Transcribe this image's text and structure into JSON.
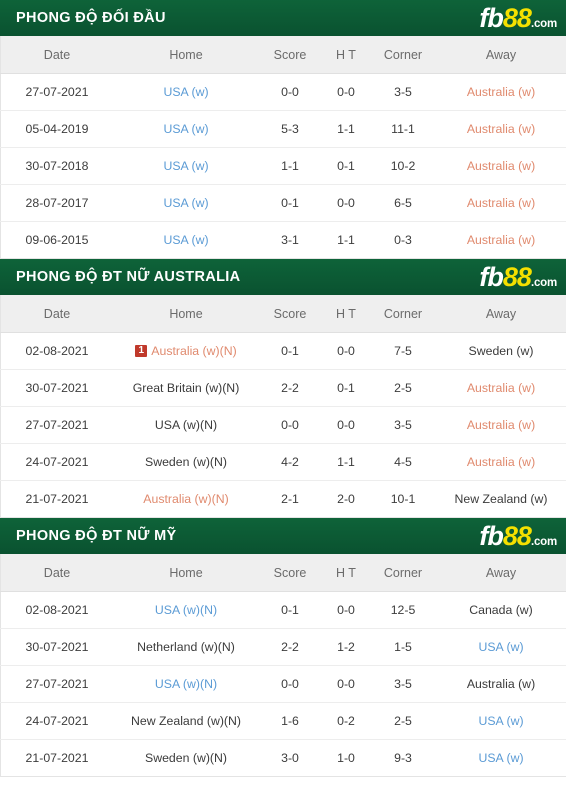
{
  "brand": {
    "logo_fb": "fb",
    "logo_88": "88",
    "logo_dotcom": ".com"
  },
  "colors": {
    "banner_green": "#0c5c35",
    "logo_yellow": "#f5e000",
    "score_red": "#cf4b4b",
    "link_blue": "#5b9bd5",
    "highlight_salmon": "#e08a6e",
    "badge_red": "#c0392b",
    "header_row_grey": "#efefef"
  },
  "columns": {
    "date": "Date",
    "home": "Home",
    "score": "Score",
    "ht": "H T",
    "corner": "Corner",
    "away": "Away"
  },
  "sections": [
    {
      "id": "head-to-head",
      "title": "PHONG ĐỘ ĐỐI ĐẦU",
      "rows": [
        {
          "date": "27-07-2021",
          "home": {
            "text": "USA (w)",
            "style": "blue",
            "badge": null
          },
          "score": "0-0",
          "ht": "0-0",
          "corner": "3-5",
          "away": {
            "text": "Australia (w)",
            "style": "salmon",
            "badge": null
          }
        },
        {
          "date": "05-04-2019",
          "home": {
            "text": "USA (w)",
            "style": "blue",
            "badge": null
          },
          "score": "5-3",
          "ht": "1-1",
          "corner": "11-1",
          "away": {
            "text": "Australia (w)",
            "style": "salmon",
            "badge": null
          }
        },
        {
          "date": "30-07-2018",
          "home": {
            "text": "USA (w)",
            "style": "blue",
            "badge": null
          },
          "score": "1-1",
          "ht": "0-1",
          "corner": "10-2",
          "away": {
            "text": "Australia (w)",
            "style": "salmon",
            "badge": null
          }
        },
        {
          "date": "28-07-2017",
          "home": {
            "text": "USA (w)",
            "style": "blue",
            "badge": null
          },
          "score": "0-1",
          "ht": "0-0",
          "corner": "6-5",
          "away": {
            "text": "Australia (w)",
            "style": "salmon",
            "badge": null
          }
        },
        {
          "date": "09-06-2015",
          "home": {
            "text": "USA (w)",
            "style": "blue",
            "badge": null
          },
          "score": "3-1",
          "ht": "1-1",
          "corner": "0-3",
          "away": {
            "text": "Australia (w)",
            "style": "salmon",
            "badge": null
          }
        }
      ]
    },
    {
      "id": "form-australia",
      "title": "PHONG ĐỘ ĐT NỮ AUSTRALIA",
      "rows": [
        {
          "date": "02-08-2021",
          "home": {
            "text": "Australia (w)(N)",
            "style": "salmon",
            "badge": "1"
          },
          "score": "0-1",
          "ht": "0-0",
          "corner": "7-5",
          "away": {
            "text": "Sweden (w)",
            "style": "plain",
            "badge": null
          }
        },
        {
          "date": "30-07-2021",
          "home": {
            "text": "Great Britain (w)(N)",
            "style": "plain",
            "badge": null
          },
          "score": "2-2",
          "ht": "0-1",
          "corner": "2-5",
          "away": {
            "text": "Australia (w)",
            "style": "salmon",
            "badge": null
          }
        },
        {
          "date": "27-07-2021",
          "home": {
            "text": "USA (w)(N)",
            "style": "plain",
            "badge": null
          },
          "score": "0-0",
          "ht": "0-0",
          "corner": "3-5",
          "away": {
            "text": "Australia (w)",
            "style": "salmon",
            "badge": null
          }
        },
        {
          "date": "24-07-2021",
          "home": {
            "text": "Sweden (w)(N)",
            "style": "plain",
            "badge": null
          },
          "score": "4-2",
          "ht": "1-1",
          "corner": "4-5",
          "away": {
            "text": "Australia (w)",
            "style": "salmon",
            "badge": null
          }
        },
        {
          "date": "21-07-2021",
          "home": {
            "text": "Australia (w)(N)",
            "style": "salmon",
            "badge": null
          },
          "score": "2-1",
          "ht": "2-0",
          "corner": "10-1",
          "away": {
            "text": "New Zealand (w)",
            "style": "plain",
            "badge": null
          }
        }
      ]
    },
    {
      "id": "form-usa",
      "title": "PHONG ĐỘ ĐT NỮ MỸ",
      "rows": [
        {
          "date": "02-08-2021",
          "home": {
            "text": "USA (w)(N)",
            "style": "blue",
            "badge": null
          },
          "score": "0-1",
          "ht": "0-0",
          "corner": "12-5",
          "away": {
            "text": "Canada (w)",
            "style": "plain",
            "badge": null
          }
        },
        {
          "date": "30-07-2021",
          "home": {
            "text": "Netherland (w)(N)",
            "style": "plain",
            "badge": null
          },
          "score": "2-2",
          "ht": "1-2",
          "corner": "1-5",
          "away": {
            "text": "USA (w)",
            "style": "blue",
            "badge": null
          }
        },
        {
          "date": "27-07-2021",
          "home": {
            "text": "USA (w)(N)",
            "style": "blue",
            "badge": null
          },
          "score": "0-0",
          "ht": "0-0",
          "corner": "3-5",
          "away": {
            "text": "Australia (w)",
            "style": "plain",
            "badge": null
          }
        },
        {
          "date": "24-07-2021",
          "home": {
            "text": "New Zealand (w)(N)",
            "style": "plain",
            "badge": null
          },
          "score": "1-6",
          "ht": "0-2",
          "corner": "2-5",
          "away": {
            "text": "USA (w)",
            "style": "blue",
            "badge": null
          }
        },
        {
          "date": "21-07-2021",
          "home": {
            "text": "Sweden (w)(N)",
            "style": "plain",
            "badge": null
          },
          "score": "3-0",
          "ht": "1-0",
          "corner": "9-3",
          "away": {
            "text": "USA (w)",
            "style": "blue",
            "badge": null
          }
        }
      ]
    }
  ]
}
